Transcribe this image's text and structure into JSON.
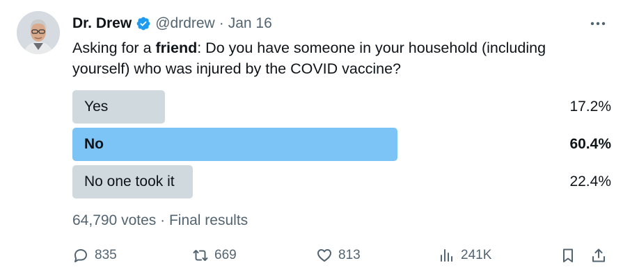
{
  "author": {
    "name": "Dr. Drew",
    "handle": "@drdrew",
    "separator": "·",
    "date": "Jan 16",
    "verified": true,
    "avatar": "avatar-photo"
  },
  "tweet": {
    "text_prefix": "Asking for a ",
    "text_bold": "friend",
    "text_suffix": ": Do you have someone in your household (including yourself) who was injured by the COVID vaccine?"
  },
  "poll": {
    "options": [
      {
        "label": "Yes",
        "percent": "17.2%",
        "value": 17.2
      },
      {
        "label": "No",
        "percent": "60.4%",
        "value": 60.4,
        "winner": true
      },
      {
        "label": "No one took it",
        "percent": "22.4%",
        "value": 22.4
      }
    ],
    "votes": "64,790 votes",
    "separator": "·",
    "status": "Final results"
  },
  "actions": {
    "replies": "835",
    "reposts": "669",
    "likes": "813",
    "views": "241K"
  },
  "icons": {
    "more": "more-icon",
    "reply": "reply-icon",
    "repost": "repost-icon",
    "like": "like-icon",
    "views": "views-icon",
    "bookmark": "bookmark-icon",
    "share": "share-icon",
    "verified": "verified-badge-icon"
  },
  "colors": {
    "verified": "#1d9bf0",
    "winner_bar": "#7cc3f6",
    "option_bar": "#cfd9de",
    "muted_text": "#536471",
    "text": "#0f1419"
  }
}
